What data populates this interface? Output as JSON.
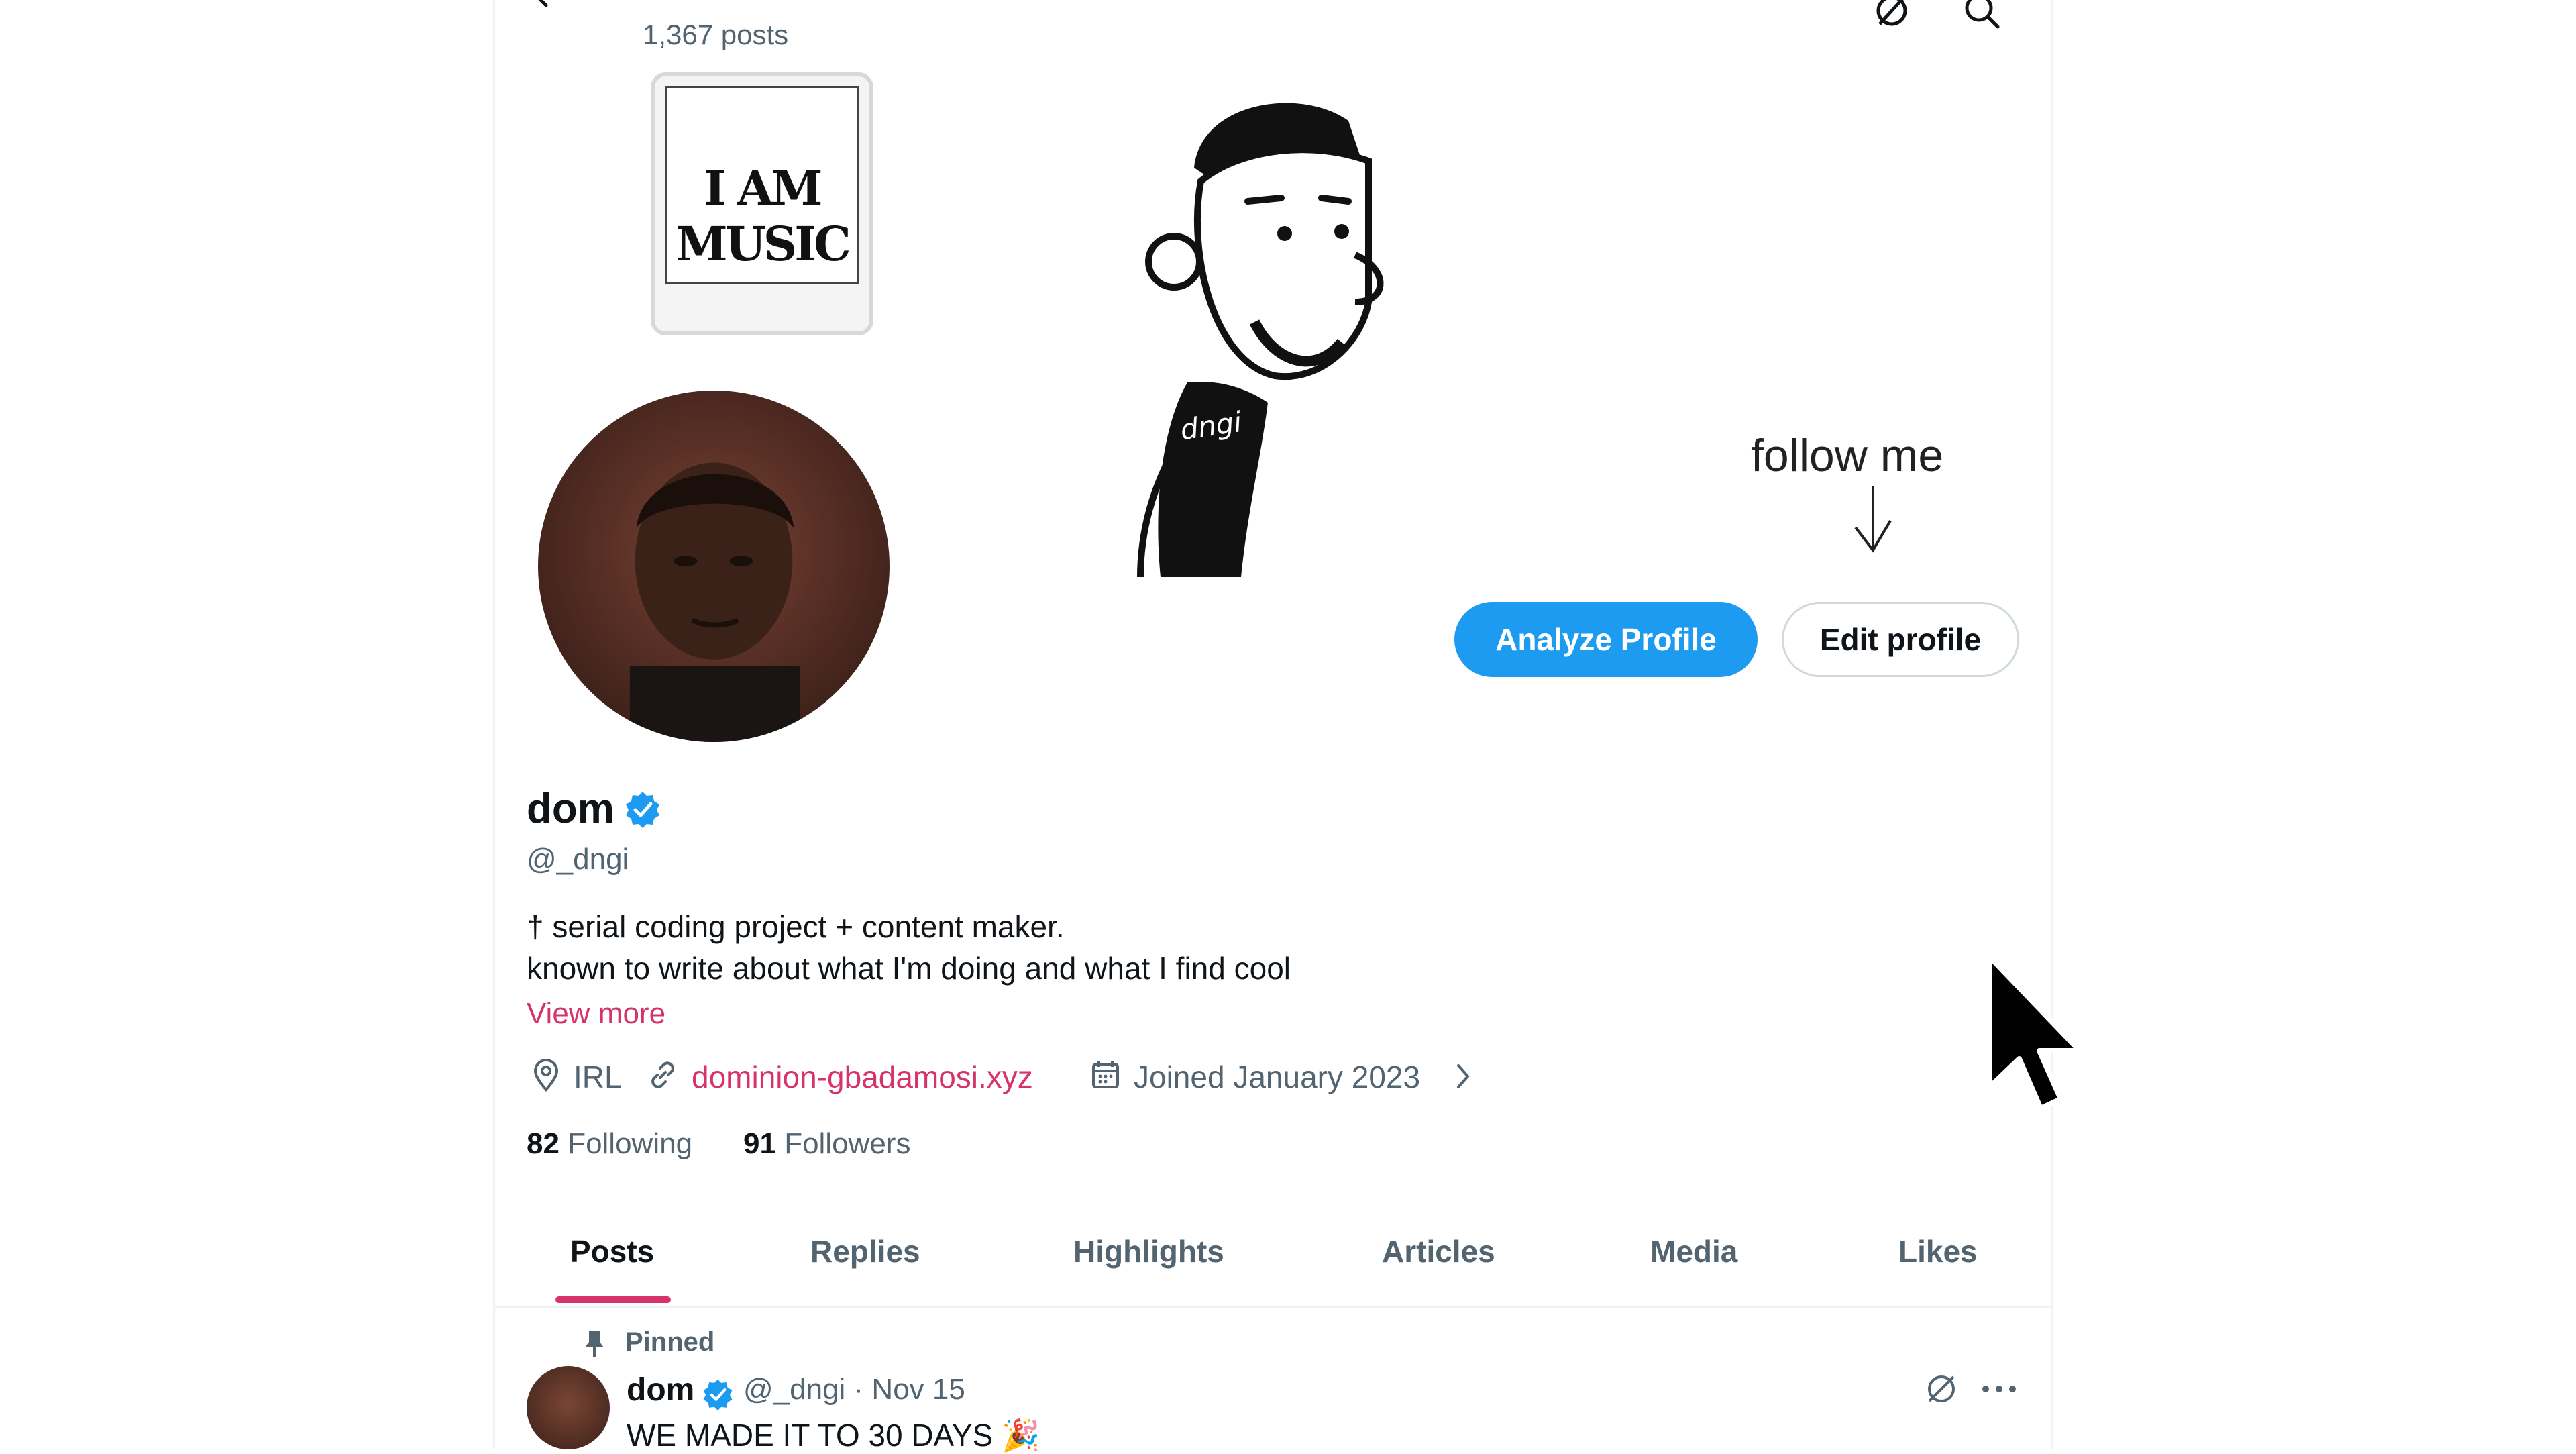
{
  "header": {
    "post_count": "1,367 posts"
  },
  "banner": {
    "sticker_text": "I AM MUSIC",
    "follow_note": "follow me",
    "shirt_text": "dngi"
  },
  "buttons": {
    "analyze": "Analyze Profile",
    "edit": "Edit profile"
  },
  "profile": {
    "name": "dom",
    "handle": "@_dngi",
    "bio_line1": "† serial coding project + content maker.",
    "bio_line2": "known to write about what I'm doing and what I find cool",
    "view_more": "View more",
    "location": "IRL",
    "website": "dominion-gbadamosi.xyz",
    "joined": "Joined January 2023",
    "following_count": "82",
    "following_label": "Following",
    "followers_count": "91",
    "followers_label": "Followers"
  },
  "tabs": [
    {
      "label": "Posts"
    },
    {
      "label": "Replies"
    },
    {
      "label": "Highlights"
    },
    {
      "label": "Articles"
    },
    {
      "label": "Media"
    },
    {
      "label": "Likes"
    }
  ],
  "post": {
    "pinned_label": "Pinned",
    "author": "dom",
    "meta": "@_dngi · Nov 15",
    "text": "WE MADE IT TO 30 DAYS 🎉"
  },
  "colors": {
    "accent": "#1d9bf0",
    "link": "#d6336c",
    "muted": "#536471"
  }
}
